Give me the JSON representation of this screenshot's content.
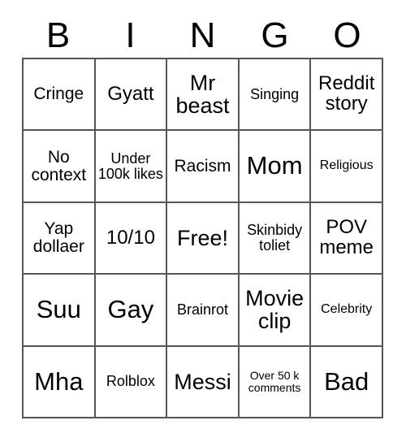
{
  "card": {
    "title": "BINGO",
    "header_letters": [
      "B",
      "I",
      "N",
      "G",
      "O"
    ],
    "columns": 5,
    "rows": 5,
    "colors": {
      "background": "#ffffff",
      "cell_background": "#ffffff",
      "border": "#555555",
      "text": "#000000"
    },
    "cells": [
      {
        "text": "Cringe",
        "size": "md",
        "free": false
      },
      {
        "text": "Gyatt",
        "size": "lg",
        "free": false
      },
      {
        "text": "Mr beast",
        "size": "xl",
        "free": false
      },
      {
        "text": "Singing",
        "size": "sm",
        "free": false
      },
      {
        "text": "Reddit story",
        "size": "lg",
        "free": false
      },
      {
        "text": "No context",
        "size": "md",
        "free": false
      },
      {
        "text": "Under 100k likes",
        "size": "sm",
        "free": false
      },
      {
        "text": "Racism",
        "size": "md",
        "free": false
      },
      {
        "text": "Mom",
        "size": "xxl",
        "free": false
      },
      {
        "text": "Religious",
        "size": "xs",
        "free": false
      },
      {
        "text": "Yap dollaer",
        "size": "md",
        "free": false
      },
      {
        "text": "10/10",
        "size": "lg",
        "free": false
      },
      {
        "text": "Free!",
        "size": "xl",
        "free": true
      },
      {
        "text": "Skinbidy toliet",
        "size": "sm",
        "free": false
      },
      {
        "text": "POV meme",
        "size": "lg",
        "free": false
      },
      {
        "text": "Suu",
        "size": "xxl",
        "free": false
      },
      {
        "text": "Gay",
        "size": "xxl",
        "free": false
      },
      {
        "text": "Brainrot",
        "size": "sm",
        "free": false
      },
      {
        "text": "Movie clip",
        "size": "xl",
        "free": false
      },
      {
        "text": "Celebrity",
        "size": "xs",
        "free": false
      },
      {
        "text": "Mha",
        "size": "xxl",
        "free": false
      },
      {
        "text": "Rolblox",
        "size": "sm",
        "free": false
      },
      {
        "text": "Messi",
        "size": "xl",
        "free": false
      },
      {
        "text": "Over 50 k comments",
        "size": "xxs",
        "free": false
      },
      {
        "text": "Bad",
        "size": "xxl",
        "free": false
      }
    ]
  }
}
